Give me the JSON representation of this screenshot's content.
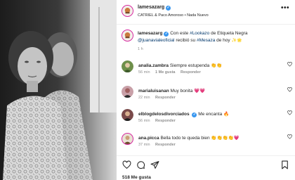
{
  "post": {
    "username": "lamesazarg",
    "subtitle": "CATRIEL & Paco Amoroso • Nada Nuevo",
    "more_label": "•••"
  },
  "caption": {
    "username": "lamesazarg",
    "text_1": "Con este",
    "tag_lookazo": "#Lookazo",
    "text_2": "de Etiqueta Negra",
    "mention": "@juanavialeoficial",
    "text_3": "recibió su",
    "tag_mesaza": "#Mesaza",
    "text_4": "de hoy",
    "emojis": "✨🌟",
    "time": "1 h"
  },
  "comments": [
    {
      "username": "analia.zambra",
      "text": "Siempre estupenda 👏👏",
      "time": "56 min",
      "likes": "1 Me gusta",
      "reply": "Responder"
    },
    {
      "username": "marialuisanan",
      "text": "Muy bonita 💗💗",
      "time": "22 min",
      "likes": "",
      "reply": "Responder"
    },
    {
      "username": "elblogdelosdivorciados",
      "text": "Me encanta 🔥",
      "time": "56 min",
      "likes": "",
      "reply": "Responder"
    },
    {
      "username": "ana.picca",
      "text": "Bella todo te queda bien 👏👏👏👏💗",
      "time": "37 min",
      "likes": "",
      "reply": "Responder"
    }
  ],
  "footer": {
    "likes_count": "518 Me gusta"
  },
  "colors": {
    "verified": "#3897f0",
    "link": "#00376b",
    "muted": "#8e8e8e",
    "story_ring": "#d6249f"
  }
}
